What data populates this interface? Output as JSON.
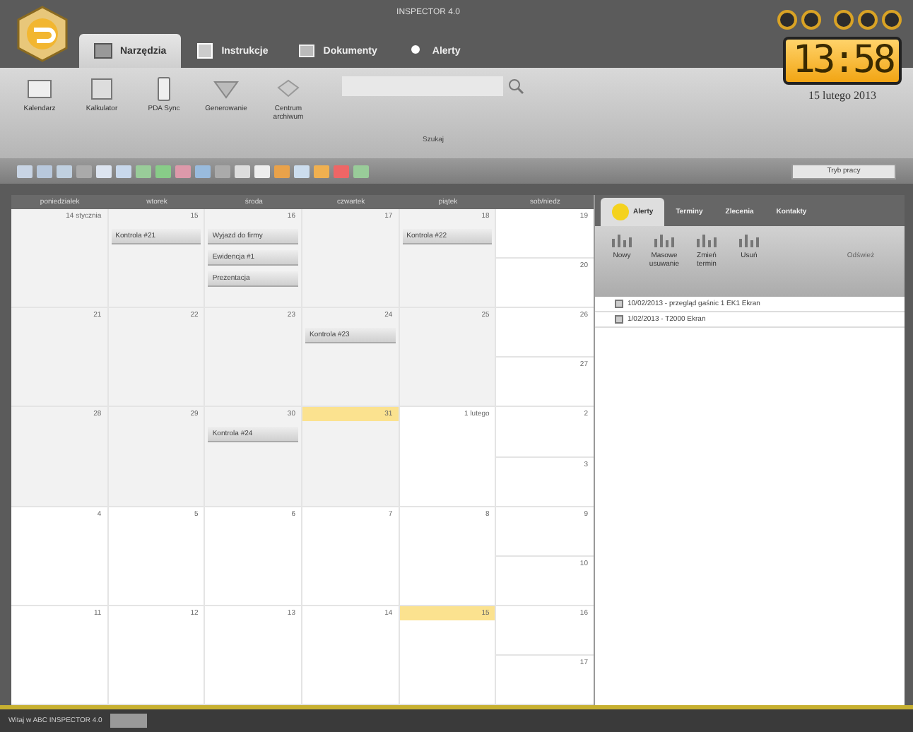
{
  "window": {
    "title": "INSPECTOR 4.0"
  },
  "main_tabs": [
    {
      "label": "Narzędzia",
      "selected": true
    },
    {
      "label": "Instrukcje",
      "selected": false
    },
    {
      "label": "Dokumenty",
      "selected": false
    },
    {
      "label": "Alerty",
      "selected": false
    }
  ],
  "ribbon": {
    "buttons": [
      {
        "label": "Kalendarz"
      },
      {
        "label": "Kalkulator"
      },
      {
        "label": "PDA Sync"
      },
      {
        "label": "Generowanie"
      },
      {
        "label": "Centrum archiwum"
      }
    ],
    "search_group": "Szukaj"
  },
  "clock": {
    "time": "13:58",
    "date": "15 lutego 2013"
  },
  "mode_select": {
    "value": "Tryb pracy"
  },
  "calendar": {
    "columns": [
      "poniedziałek",
      "wtorek",
      "środa",
      "czwartek",
      "piątek",
      "sob/niedz"
    ],
    "weeks": [
      {
        "days": [
          {
            "label": "14 stycznia",
            "shaded": true,
            "highlight": false
          },
          {
            "label": "15",
            "shaded": true,
            "highlight": false,
            "events": [
              "Kontrola #21"
            ]
          },
          {
            "label": "16",
            "shaded": true,
            "highlight": false,
            "events": [
              "Wyjazd do firmy",
              "Ewidencja #1",
              "Prezentacja"
            ]
          },
          {
            "label": "17",
            "shaded": true,
            "highlight": false
          },
          {
            "label": "18",
            "shaded": true,
            "highlight": false,
            "events": [
              "Kontrola #22"
            ]
          }
        ],
        "weekend": [
          "19",
          "20"
        ]
      },
      {
        "days": [
          {
            "label": "21",
            "shaded": true,
            "highlight": false
          },
          {
            "label": "22",
            "shaded": true,
            "highlight": false
          },
          {
            "label": "23",
            "shaded": true,
            "highlight": false
          },
          {
            "label": "24",
            "shaded": true,
            "highlight": false,
            "events": [
              "Kontrola #23"
            ]
          },
          {
            "label": "25",
            "shaded": true,
            "highlight": false
          }
        ],
        "weekend": [
          "26",
          "27"
        ]
      },
      {
        "days": [
          {
            "label": "28",
            "shaded": true,
            "highlight": false
          },
          {
            "label": "29",
            "shaded": true,
            "highlight": false
          },
          {
            "label": "30",
            "shaded": true,
            "highlight": false,
            "events": [
              "Kontrola #24"
            ]
          },
          {
            "label": "31",
            "shaded": true,
            "highlight": true
          },
          {
            "label": "1 lutego",
            "shaded": false,
            "highlight": false
          }
        ],
        "weekend": [
          "2",
          "3"
        ]
      },
      {
        "days": [
          {
            "label": "4",
            "shaded": false,
            "highlight": false
          },
          {
            "label": "5",
            "shaded": false,
            "highlight": false
          },
          {
            "label": "6",
            "shaded": false,
            "highlight": false
          },
          {
            "label": "7",
            "shaded": false,
            "highlight": false
          },
          {
            "label": "8",
            "shaded": false,
            "highlight": false
          }
        ],
        "weekend": [
          "9",
          "10"
        ]
      },
      {
        "days": [
          {
            "label": "11",
            "shaded": false,
            "highlight": false
          },
          {
            "label": "12",
            "shaded": false,
            "highlight": false
          },
          {
            "label": "13",
            "shaded": false,
            "highlight": false
          },
          {
            "label": "14",
            "shaded": false,
            "highlight": false
          },
          {
            "label": "15",
            "shaded": false,
            "highlight": true
          }
        ],
        "weekend": [
          "16",
          "17"
        ]
      }
    ]
  },
  "side_panel": {
    "tabs": [
      {
        "label": "Alerty",
        "selected": true
      },
      {
        "label": "Terminy",
        "selected": false
      },
      {
        "label": "Zlecenia",
        "selected": false
      },
      {
        "label": "Kontakty",
        "selected": false
      }
    ],
    "buttons": [
      {
        "label": "Nowy",
        "disabled": false
      },
      {
        "label": "Masowe usuwanie",
        "disabled": false
      },
      {
        "label": "Zmień termin",
        "disabled": false
      },
      {
        "label": "Usuń",
        "disabled": false
      },
      {
        "label": "Odśwież",
        "disabled": true
      }
    ],
    "items": [
      "10/02/2013 - przegląd gaśnic 1 EK1 Ekran",
      "1/02/2013 - T2000 Ekran"
    ]
  },
  "status_bar": {
    "text": "Witaj w ABC INSPECTOR 4.0"
  }
}
